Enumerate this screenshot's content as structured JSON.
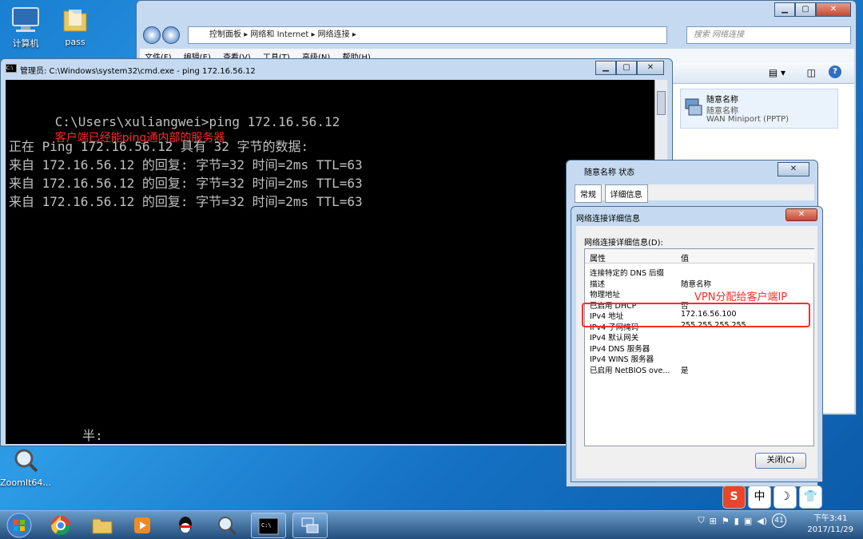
{
  "desktop": {
    "icons": [
      {
        "label": "计算机"
      },
      {
        "label": "pass"
      },
      {
        "label": "ZoomIt64..."
      }
    ]
  },
  "explorer": {
    "breadcrumb": [
      "控制面板",
      "网络和 Internet",
      "网络连接"
    ],
    "search_placeholder": "搜索 网络连接",
    "menu": [
      "文件(F)",
      "编辑(E)",
      "查看(V)",
      "工具(T)",
      "高级(N)",
      "帮助(H)"
    ],
    "vpn_item": {
      "name": "随意名称",
      "status": "随意名称",
      "device": "WAN Miniport (PPTP)"
    }
  },
  "cmd": {
    "title": "管理员: C:\\Windows\\system32\\cmd.exe - ping  172.16.56.12",
    "prompt": "C:\\Users\\xuliangwei>ping 172.16.56.12",
    "annotation": "客户端已经能ping通内部的服务器",
    "lines": [
      "正在 Ping 172.16.56.12 具有 32 字节的数据:",
      "来自 172.16.56.12 的回复: 字节=32 时间=2ms TTL=63",
      "来自 172.16.56.12 的回复: 字节=32 时间=2ms TTL=63",
      "来自 172.16.56.12 的回复: 字节=32 时间=2ms TTL=63"
    ],
    "ime_hint": "半:"
  },
  "status_dialog": {
    "title": "随意名称 状态",
    "tabs": [
      "常规",
      "详细信息"
    ]
  },
  "details_dialog": {
    "title": "网络连接详细信息",
    "caption": "网络连接详细信息(D):",
    "col_property": "属性",
    "col_value": "值",
    "rows": [
      {
        "k": "连接特定的 DNS 后缀",
        "v": ""
      },
      {
        "k": "描述",
        "v": "随意名称"
      },
      {
        "k": "物理地址",
        "v": ""
      },
      {
        "k": "已启用 DHCP",
        "v": "否"
      },
      {
        "k": "IPv4 地址",
        "v": "172.16.56.100"
      },
      {
        "k": "IPv4 子网掩码",
        "v": "255.255.255.255"
      },
      {
        "k": "IPv4 默认网关",
        "v": ""
      },
      {
        "k": "IPv4 DNS 服务器",
        "v": ""
      },
      {
        "k": "IPv4 WINS 服务器",
        "v": ""
      },
      {
        "k": "已启用 NetBIOS ove...",
        "v": "是"
      }
    ],
    "annotation": "VPN分配给客户端IP",
    "close_label": "关闭(C)"
  },
  "ime": {
    "buttons": [
      "S",
      "中",
      "☽",
      "👕"
    ]
  },
  "taskbar": {
    "clock_time": "下午3:41",
    "clock_date": "2017/11/29",
    "volume": "41"
  }
}
